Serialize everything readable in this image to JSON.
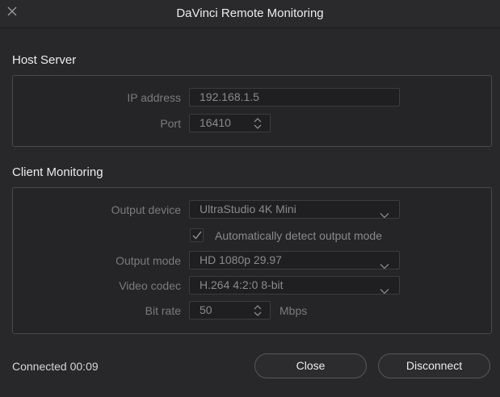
{
  "window": {
    "title": "DaVinci Remote Monitoring"
  },
  "host_server": {
    "heading": "Host Server",
    "ip_label": "IP address",
    "ip_value": "192.168.1.5",
    "port_label": "Port",
    "port_value": "16410"
  },
  "client_monitoring": {
    "heading": "Client Monitoring",
    "output_device_label": "Output device",
    "output_device_value": "UltraStudio 4K Mini",
    "auto_detect_label": "Automatically detect output mode",
    "auto_detect_checked": true,
    "output_mode_label": "Output mode",
    "output_mode_value": "HD 1080p 29.97",
    "video_codec_label": "Video codec",
    "video_codec_value": "H.264 4:2:0 8-bit",
    "bit_rate_label": "Bit rate",
    "bit_rate_value": "50",
    "bit_rate_unit": "Mbps"
  },
  "footer": {
    "status": "Connected 00:09",
    "close_label": "Close",
    "disconnect_label": "Disconnect"
  },
  "icons": {
    "close": "close-icon",
    "stepper": "stepper-arrows-icon",
    "chevron": "chevron-down-icon",
    "check": "checkmark-icon"
  },
  "colors": {
    "background": "#28282a",
    "field": "#1f1f21",
    "border": "#4a4a4c",
    "disabled_text": "#7b7b7d"
  }
}
